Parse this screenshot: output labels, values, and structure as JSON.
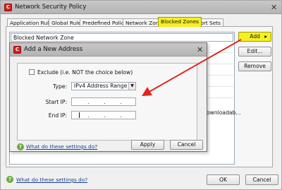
{
  "window": {
    "title": "Network Security Policy",
    "close": "✕",
    "tabs": [
      "Application Rules",
      "Global Rules",
      "Predefined Policies",
      "Network Zones",
      "Blocked Zones",
      "Port Sets"
    ],
    "active_tab": "Blocked Zones",
    "list_rows": [
      "Blocked Network Zone",
      "",
      "",
      "",
      "",
      "",
      "ownloadab..."
    ],
    "buttons": {
      "add": "Add",
      "add_arrow": "▸",
      "edit": "Edit...",
      "remove": "Remove"
    },
    "help_link": "What do these settings do?",
    "ok": "OK",
    "cancel": "Cancel"
  },
  "dialog": {
    "title": "Add a New Address",
    "close": "✕",
    "exclude_label": "Exclude (i.e. NOT the choice below)",
    "exclude_checked": false,
    "type_label": "Type:",
    "type_value": "IPv4 Address Range",
    "start_label": "Start IP:",
    "end_label": "End IP:",
    "help_link": "What do these settings do?",
    "apply": "Apply",
    "cancel": "Cancel"
  },
  "icons": {
    "app": "comodo-app-icon",
    "help": "help-question-icon",
    "dropdown": "chevron-down-icon"
  },
  "colors": {
    "highlight": "#f6ef24",
    "arrow": "#e0261e",
    "link": "#1a3f8f",
    "help": "#6bab3a"
  }
}
